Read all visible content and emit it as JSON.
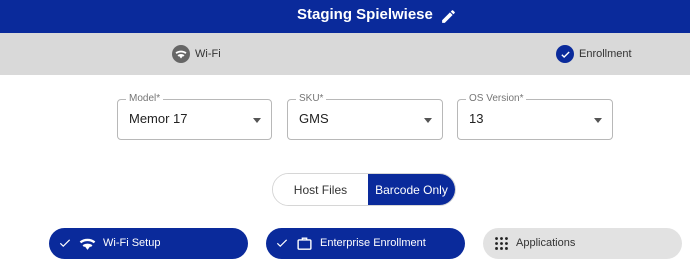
{
  "header": {
    "title": "Staging Spielwiese",
    "edit_icon": "pencil-icon"
  },
  "steps": [
    {
      "label": "Wi-Fi",
      "icon": "wifi-icon",
      "state": "inactive"
    },
    {
      "label": "Enrollment",
      "icon": "check-icon",
      "state": "done"
    }
  ],
  "fields": {
    "model": {
      "label": "Model*",
      "value": "Memor 17"
    },
    "sku": {
      "label": "SKU*",
      "value": "GMS"
    },
    "os": {
      "label": "OS Version*",
      "value": "13"
    }
  },
  "toggle": {
    "options": [
      "Host Files",
      "Barcode Only"
    ],
    "selected": "Barcode Only"
  },
  "sections": [
    {
      "label": "Wi-Fi Setup",
      "icon": "wifi-icon",
      "completed": true
    },
    {
      "label": "Enterprise Enrollment",
      "icon": "briefcase-icon",
      "completed": true
    },
    {
      "label": "Applications",
      "icon": "apps-grid-icon",
      "completed": false
    }
  ],
  "colors": {
    "primary": "#0a2a9b",
    "stepbar": "#d9d9d9",
    "inactive_pill": "#e2e2e2"
  }
}
